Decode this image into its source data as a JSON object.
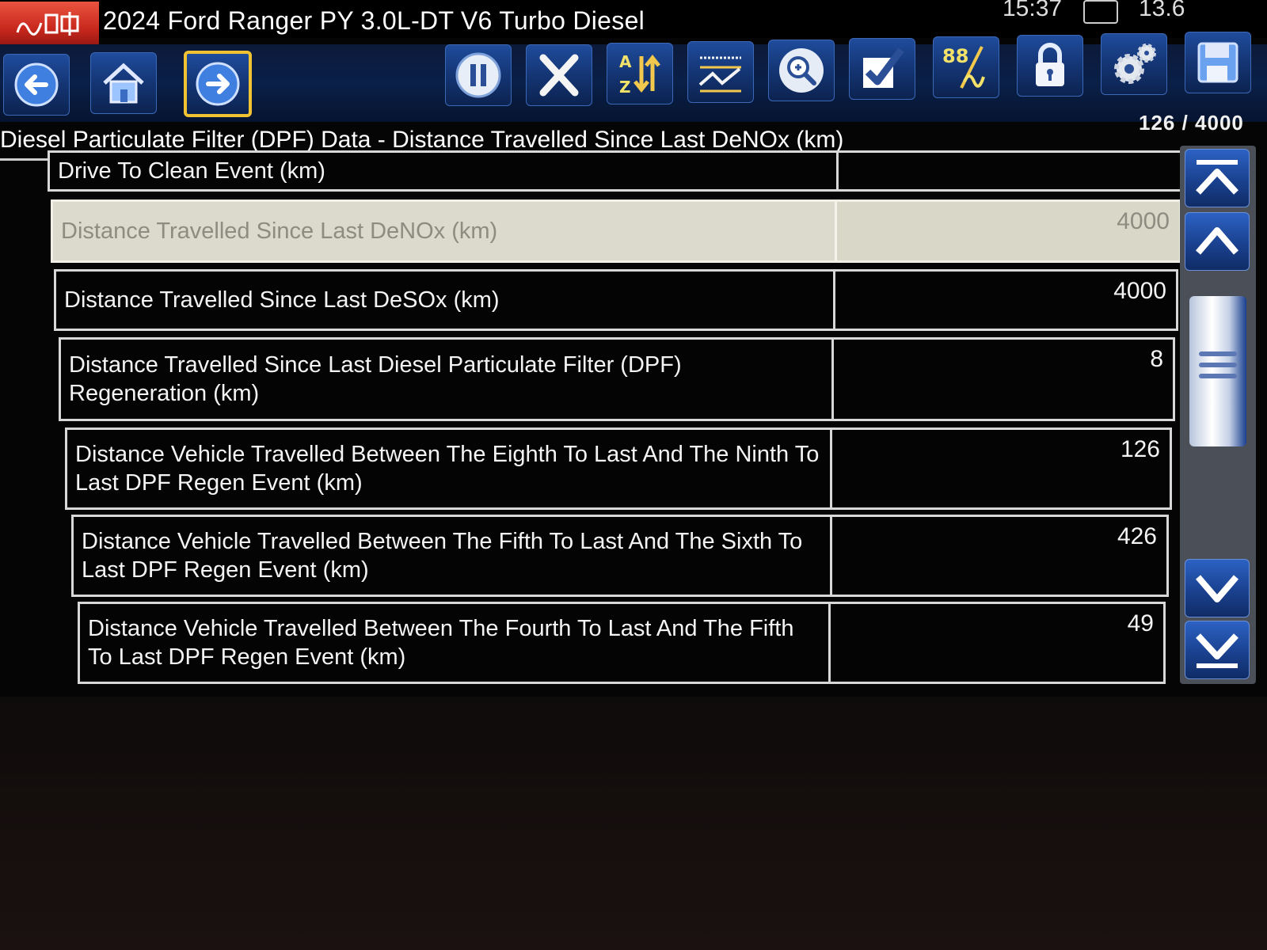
{
  "window": {
    "vehicle_title": "2024 Ford Ranger PY 3.0L-DT V6 Turbo Diesel",
    "clock": "15:37",
    "voltage": "13.6"
  },
  "toolbar": {
    "buttons": [
      {
        "name": "back-button",
        "icon": "back-arrow-icon"
      },
      {
        "name": "home-button",
        "icon": "home-icon"
      },
      {
        "name": "forward-button",
        "icon": "forward-arrow-icon",
        "selected": true
      },
      {
        "name": "pause-button",
        "icon": "pause-icon"
      },
      {
        "name": "clear-button",
        "icon": "close-x-icon"
      },
      {
        "name": "sort-button",
        "icon": "sort-az-icon"
      },
      {
        "name": "graph-button",
        "icon": "graph-icon"
      },
      {
        "name": "zoom-button",
        "icon": "zoom-icon"
      },
      {
        "name": "select-button",
        "icon": "checkmark-icon"
      },
      {
        "name": "units-button",
        "icon": "units-88-icon"
      },
      {
        "name": "lock-button",
        "icon": "lock-icon"
      },
      {
        "name": "settings-button",
        "icon": "gear-icon"
      },
      {
        "name": "save-button",
        "icon": "save-icon"
      }
    ]
  },
  "header": {
    "title": "Diesel Particulate Filter (DPF) Data - Distance Travelled Since Last DeNOx (km)",
    "counter": "126 / 4000"
  },
  "table": {
    "rows": [
      {
        "name": "Drive To Clean Event (km)",
        "value": ""
      },
      {
        "name": "Distance Travelled Since Last DeNOx (km)",
        "value": "4000",
        "selected": true
      },
      {
        "name": "Distance Travelled Since Last DeSOx (km)",
        "value": "4000"
      },
      {
        "name": "Distance Travelled Since Last Diesel Particulate Filter (DPF) Regeneration (km)",
        "value": "8"
      },
      {
        "name": "Distance Vehicle Travelled Between The Eighth To Last And The Ninth To Last DPF Regen Event (km)",
        "value": "126"
      },
      {
        "name": "Distance Vehicle Travelled Between The Fifth To Last And The Sixth To Last DPF Regen Event (km)",
        "value": "426"
      },
      {
        "name": "Distance Vehicle Travelled Between The Fourth To Last And The Fifth To Last DPF Regen Event (km)",
        "value": "49"
      }
    ]
  },
  "colors": {
    "accent": "#f1c232",
    "toolbar_blue": "#143574",
    "selected_row": "#d9d7c8"
  }
}
